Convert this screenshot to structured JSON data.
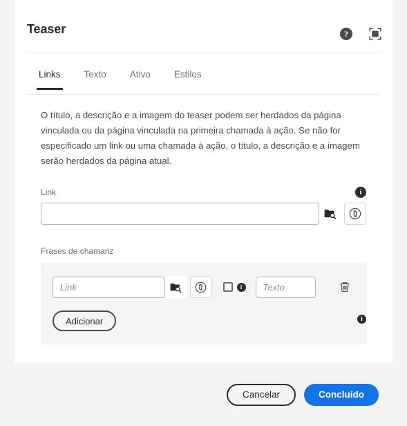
{
  "dialog": {
    "title": "Teaser",
    "help_icon": "help-circle-icon",
    "fullscreen_icon": "fullscreen-expand-icon",
    "help_glyph": "?",
    "info_glyph": "i"
  },
  "tabs": [
    {
      "label": "Links",
      "active": true
    },
    {
      "label": "Texto",
      "active": false
    },
    {
      "label": "Ativo",
      "active": false
    },
    {
      "label": "Estilos",
      "active": false
    }
  ],
  "description": "O título, a descrição e a imagem do teaser podem ser herdados da página vinculada ou da página vinculada na primeira chamada à ação. Se não for especificado um link ou uma chamada à ação, o título, a descrição e a imagem serão herdados da página atual.",
  "link_field": {
    "label": "Link",
    "value": "",
    "placeholder": "",
    "browse_icon": "folder-search-icon",
    "link_icon": "link-circle-icon",
    "info_icon": "info-icon"
  },
  "cta_section": {
    "label": "Frases de chamariz",
    "info_icon": "info-icon",
    "rows": [
      {
        "link_value": "",
        "link_placeholder": "Link",
        "browse_icon": "folder-search-icon",
        "link_icon": "link-circle-icon",
        "checkbox_checked": false,
        "row_info_icon": "info-icon",
        "text_value": "",
        "text_placeholder": "Texto",
        "delete_icon": "trash-icon"
      }
    ],
    "add_label": "Adicionar"
  },
  "footer": {
    "cancel_label": "Cancelar",
    "confirm_label": "Concluído"
  },
  "colors": {
    "primary": "#1473E6",
    "panel": "#FFFFFF",
    "page_background": "#F4F4F4",
    "cta_box": "#F5F5F5",
    "text": "#2C2C2C",
    "muted_text": "#6E6E6E"
  }
}
